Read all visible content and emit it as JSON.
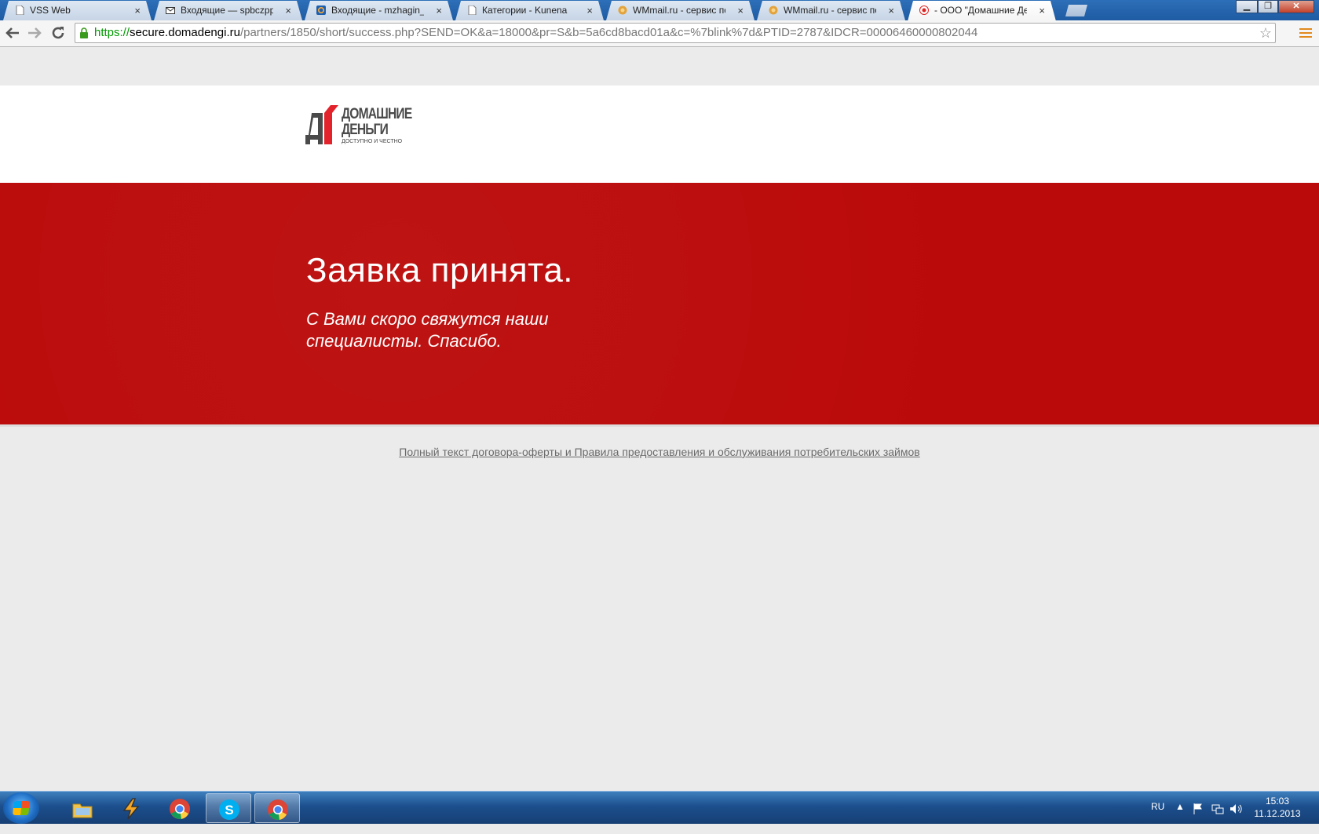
{
  "browser": {
    "tabs": [
      {
        "label": "VSS Web",
        "icon": "page-icon"
      },
      {
        "label": "Входящие — spbczpp@ra",
        "icon": "mail-icon"
      },
      {
        "label": "Входящие - mzhagin_czp",
        "icon": "mailru-icon"
      },
      {
        "label": "Категории - Kunena",
        "icon": "page-icon"
      },
      {
        "label": "WMmail.ru - сервис почт",
        "icon": "wmmail-icon"
      },
      {
        "label": "WMmail.ru - сервис почт",
        "icon": "wmmail-icon"
      },
      {
        "label": "- ООО \"Домашние Деньги",
        "icon": "domadengi-icon"
      }
    ],
    "active_tab_index": 6,
    "tab_close_glyph": "×",
    "url": {
      "scheme": "https://",
      "host": "secure.domadengi.ru",
      "path": "/partners/1850/short/success.php?SEND=OK&a=18000&pr=S&b=5a6cd8bacd01a&c=%7blink%7d&PTID=2787&IDCR=00006460000802044"
    }
  },
  "page": {
    "logo": {
      "brand_line1": "ДОМАШНИЕ",
      "brand_line2": "ДЕНЬГИ",
      "slogan": "ДОСТУПНО И ЧЕСТНО"
    },
    "hero": {
      "title": "Заявка принята.",
      "text": "С Вами скоро свяжутся наши специалисты. Спасибо."
    },
    "footer_link": "Полный текст договора-оферты и Правила предоставления и обслуживания потребительских займов"
  },
  "taskbar": {
    "pinned": [
      "explorer-icon",
      "winamp-icon",
      "chrome-icon",
      "skype-icon",
      "chrome-icon"
    ],
    "language": "RU",
    "time": "15:03",
    "date": "11.12.2013"
  },
  "colors": {
    "hero_red": "#bb0a0a",
    "logo_red": "#e3232b",
    "logo_gray": "#4a4a4a",
    "url_green": "#009a00"
  }
}
